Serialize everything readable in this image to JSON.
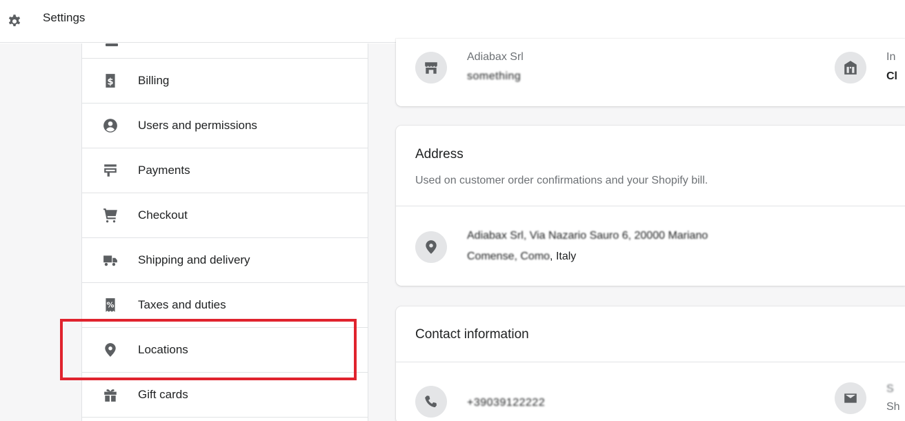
{
  "header": {
    "title": "Settings",
    "icon": "gear-icon"
  },
  "sidebar": {
    "items": [
      {
        "label": "Billing",
        "icon": "billing-icon"
      },
      {
        "label": "Users and permissions",
        "icon": "user-icon"
      },
      {
        "label": "Payments",
        "icon": "payments-icon"
      },
      {
        "label": "Checkout",
        "icon": "cart-icon"
      },
      {
        "label": "Shipping and delivery",
        "icon": "truck-icon"
      },
      {
        "label": "Taxes and duties",
        "icon": "tax-receipt-icon"
      },
      {
        "label": "Locations",
        "icon": "location-pin-icon",
        "highlighted": true
      },
      {
        "label": "Gift cards",
        "icon": "gift-icon"
      }
    ]
  },
  "store_details": {
    "store_name": "Adiabax Srl",
    "store_sub": "something",
    "right_label": "In",
    "right_value": "Cl"
  },
  "address": {
    "heading": "Address",
    "description": "Used on customer order confirmations and your Shopify bill.",
    "line1": "Adiabax Srl, Via Nazario Sauro 6, 20000 Mariano",
    "line2_prefix": "Comense, Como",
    "line2_suffix": ", Italy"
  },
  "contact": {
    "heading": "Contact information",
    "phone": "+39039122222",
    "right_label": "S",
    "right_value": "Sh"
  },
  "colors": {
    "highlight": "#e0232e",
    "icon": "#5c5f62",
    "text": "#202223",
    "subdued": "#6d7175",
    "background": "#f6f6f7"
  }
}
